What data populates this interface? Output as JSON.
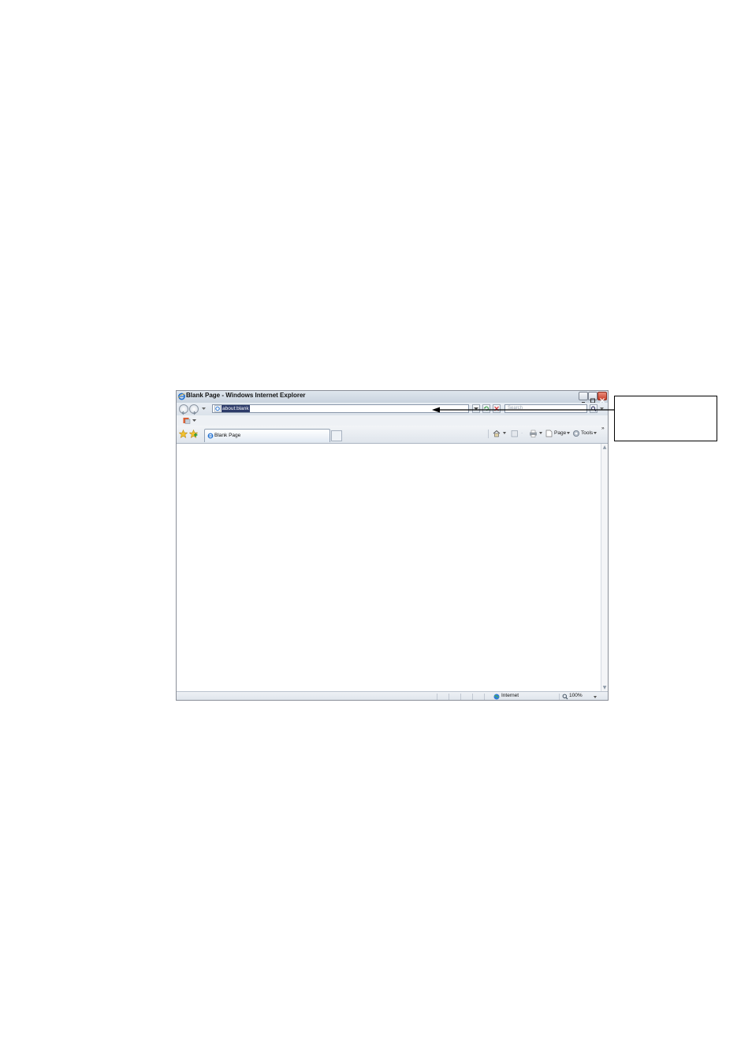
{
  "window": {
    "title": "Blank Page - Windows Internet Explorer",
    "controls": [
      "minimize",
      "maximize",
      "close"
    ]
  },
  "address_bar": {
    "url": "about:blank",
    "search_placeholder": "Search"
  },
  "tabs": [
    {
      "label": "Blank Page",
      "icon": "ie-icon"
    }
  ],
  "command_bar": {
    "page_label": "Page",
    "tools_label": "Tools",
    "overflow": "»"
  },
  "status_bar": {
    "zone": "Internet",
    "zoom": "100%"
  },
  "annotation": {
    "callout_text": ""
  },
  "colors": {
    "titlebar": "#c9d3de",
    "close_button": "#c8412b",
    "selection": "#2d3b69"
  }
}
